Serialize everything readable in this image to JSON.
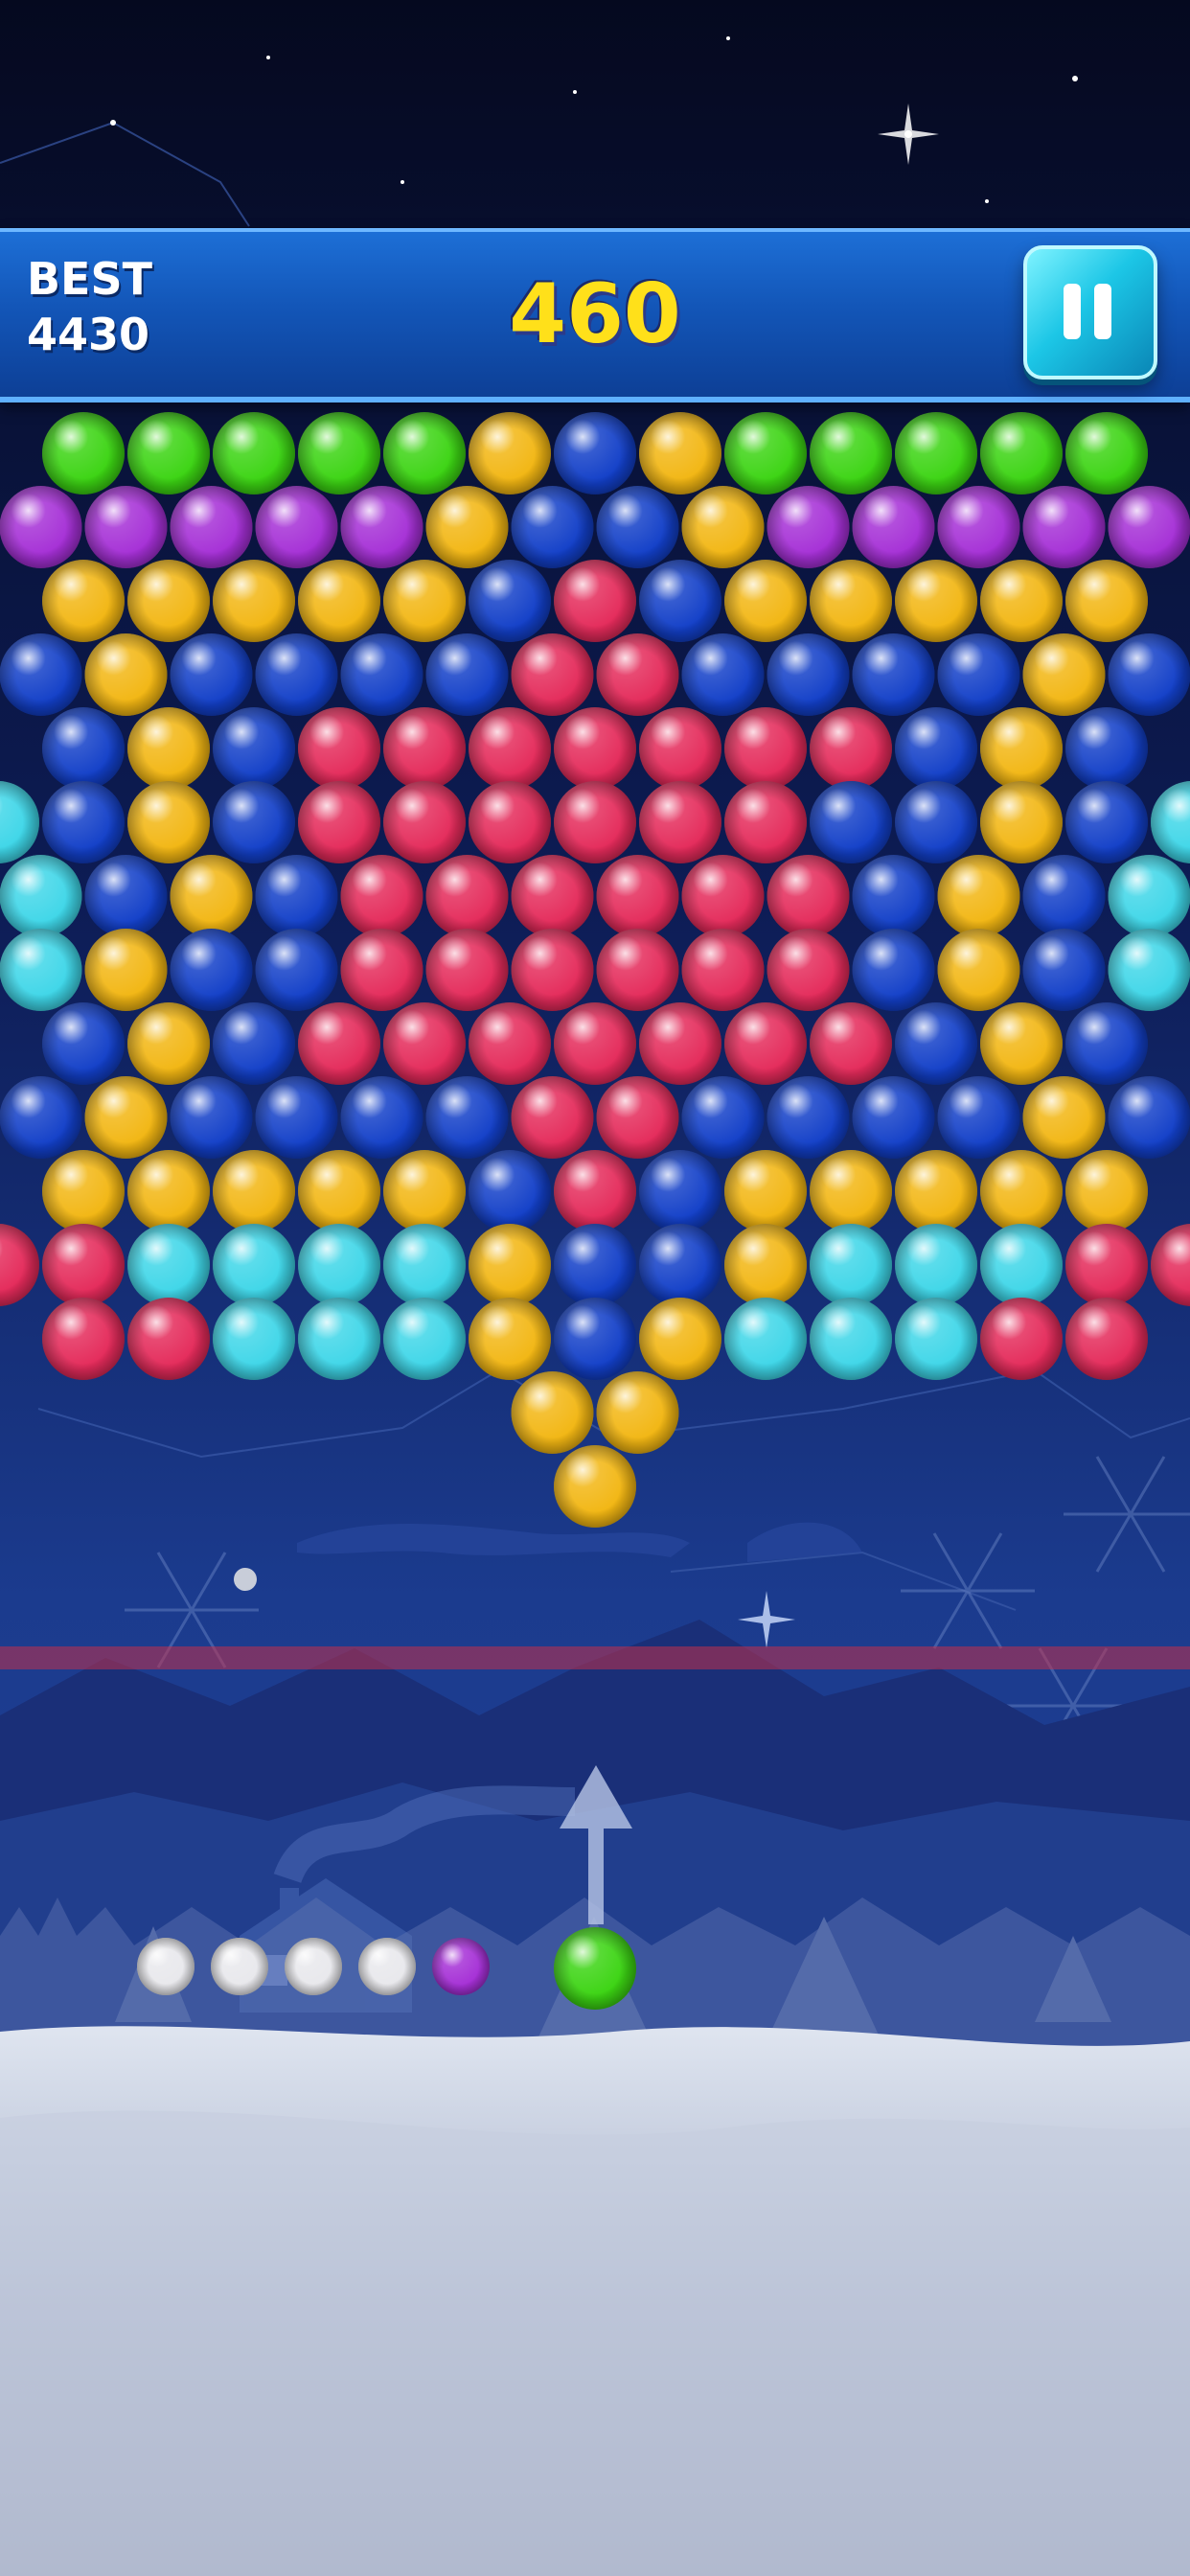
{
  "hud": {
    "best_label": "BEST",
    "best_value": "4430",
    "score": "460"
  },
  "colors": {
    "g": "#3bd412",
    "p": "#a52fd6",
    "y": "#f2b612",
    "b": "#123fc8",
    "r": "#e42a5a",
    "c": "#3ed6e8",
    "w": "#e8e8ec"
  },
  "board": {
    "rows": [
      "gggggybyggggg",
      "pppppybbyppppp",
      "yyyyybrbyyyyy",
      "bybbbbrrbbbbyb",
      "bybrrrrrrrbyb",
      "cbybrrrrrrbbybc",
      "cbybrrrrrrbybc",
      "cybbrrrrrrbybc",
      "bybrrrrrrrbyb",
      "bybbbbrrbbbbyb",
      "yyyyybrbyyyyy",
      "rrccccybbycccrr",
      "rrcccybycccrr",
      "yy",
      "y"
    ]
  },
  "shooter": {
    "current_bubble": "g",
    "queue": [
      "w",
      "w",
      "w",
      "w",
      "p"
    ]
  },
  "icons": {
    "pause": "pause-icon",
    "aim": "aim-arrow-icon"
  }
}
